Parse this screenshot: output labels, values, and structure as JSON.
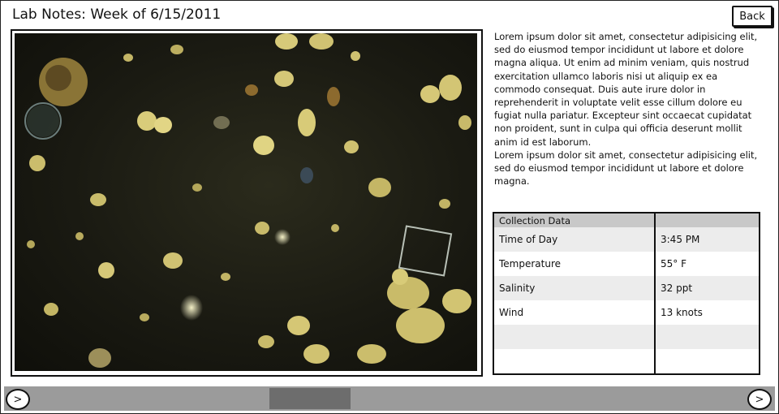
{
  "header": {
    "title": "Lab Notes: Week of 6/15/2011",
    "back_label": "Back"
  },
  "notes": {
    "paragraph1": "Lorem ipsum dolor sit amet, consectetur adipisicing elit, sed do eiusmod tempor incididunt ut labore et dolore magna aliqua. Ut enim ad minim veniam, quis nostrud exercitation ullamco laboris nisi ut aliquip ex ea commodo consequat. Duis aute irure dolor in reprehenderit in voluptate velit esse cillum dolore eu fugiat nulla pariatur. Excepteur sint occaecat cupidatat non proident, sunt in culpa qui officia deserunt mollit anim id est laborum.",
    "paragraph2": "Lorem ipsum dolor sit amet, consectetur adipisicing elit, sed do eiusmod tempor incididunt ut labore et dolore magna."
  },
  "collection_table": {
    "header": "Collection Data",
    "rows": [
      {
        "label": "Time of Day",
        "value": "3:45 PM"
      },
      {
        "label": "Temperature",
        "value": "55° F"
      },
      {
        "label": "Salinity",
        "value": "32 ppt"
      },
      {
        "label": "Wind",
        "value": "13 knots"
      },
      {
        "label": "",
        "value": ""
      },
      {
        "label": "",
        "value": ""
      }
    ]
  },
  "navigation": {
    "prev_label": ">",
    "next_label": ">"
  },
  "icons": {
    "image": "microscope-sample-image"
  }
}
